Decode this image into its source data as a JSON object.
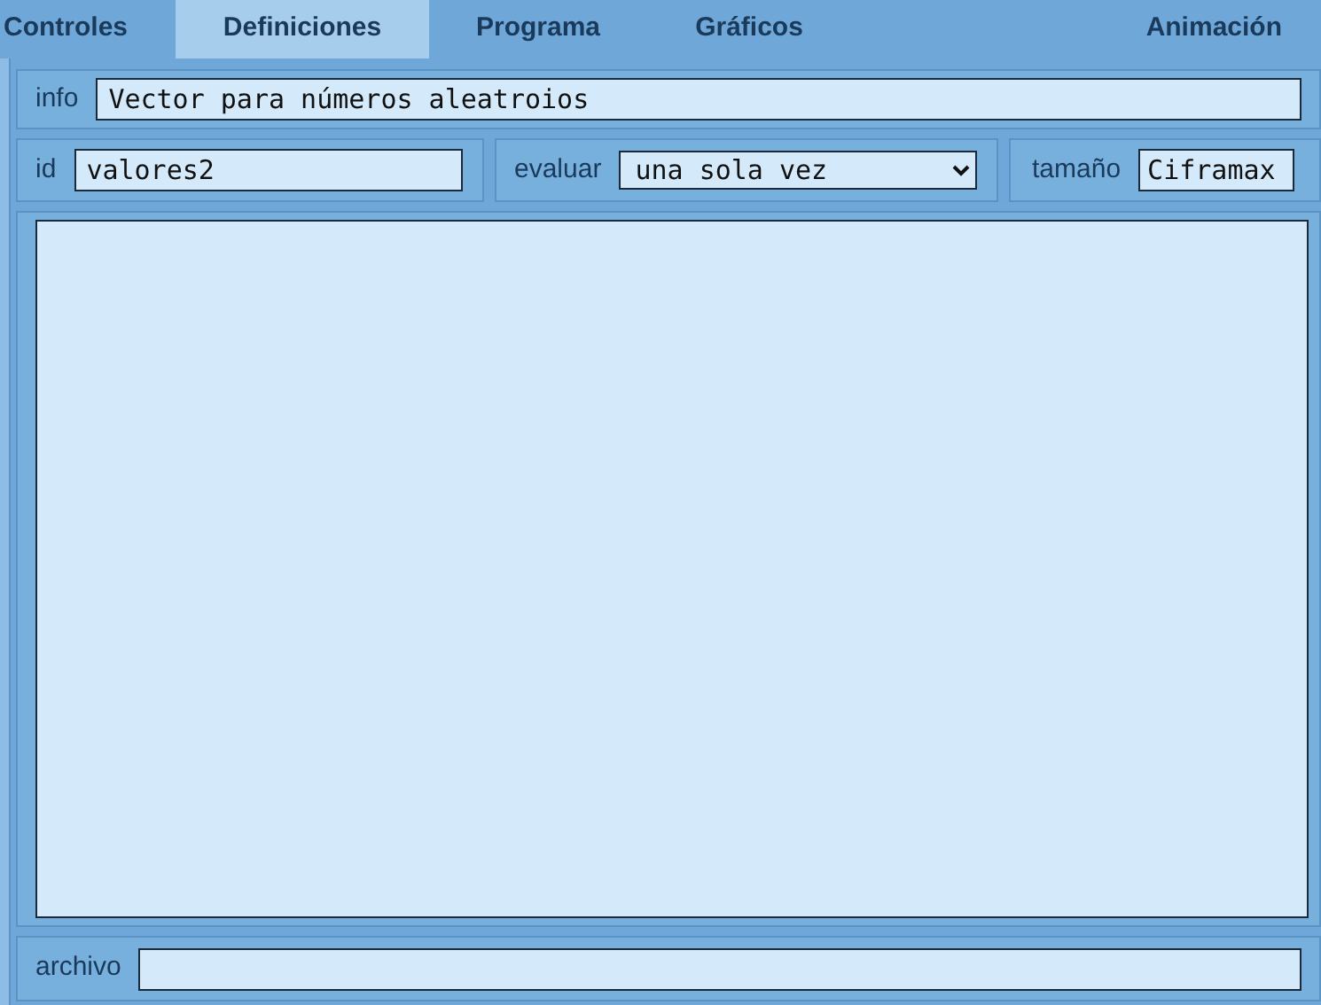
{
  "tabs": [
    {
      "label": "Controles",
      "selected": false
    },
    {
      "label": "Definiciones",
      "selected": true
    },
    {
      "label": "Programa",
      "selected": false
    },
    {
      "label": "Gráficos",
      "selected": false
    },
    {
      "label": "Animación",
      "selected": false
    }
  ],
  "info": {
    "label": "info",
    "value": "Vector para números aleatroios"
  },
  "id": {
    "label": "id",
    "value": "valores2"
  },
  "evaluar": {
    "label": "evaluar",
    "value": "una sola vez"
  },
  "tamano": {
    "label": "tamaño",
    "value": "Ciframax"
  },
  "archivo": {
    "label": "archivo"
  }
}
